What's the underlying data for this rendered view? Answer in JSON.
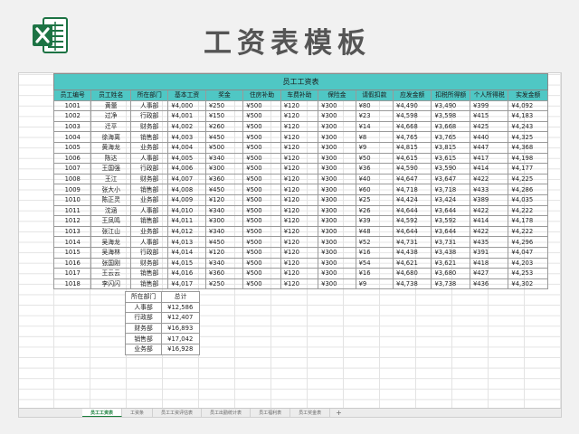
{
  "banner": {
    "title": "工资表模板",
    "logo_icon": "excel-logo-icon",
    "logo_color": "#1d7344"
  },
  "colors": {
    "header_teal": "#4fc7c4",
    "active_tab": "#1a7f3c"
  },
  "sheet": {
    "title": "员工工资表",
    "headers": [
      "员工编号",
      "员工姓名",
      "所在部门",
      "基本工资",
      "奖金",
      "住房补助",
      "车费补助",
      "保险金",
      "请假扣款",
      "应发金额",
      "扣税所得额",
      "个人所得税",
      "实发金额"
    ],
    "rows": [
      [
        "1001",
        "黄蕾",
        "人事部",
        "¥4,000",
        "¥250",
        "¥500",
        "¥120",
        "¥300",
        "¥80",
        "¥4,490",
        "¥3,490",
        "¥399",
        "¥4,092"
      ],
      [
        "1002",
        "过净",
        "行政部",
        "¥4,001",
        "¥150",
        "¥500",
        "¥120",
        "¥300",
        "¥23",
        "¥4,598",
        "¥3,598",
        "¥415",
        "¥4,183"
      ],
      [
        "1003",
        "迁平",
        "财务部",
        "¥4,002",
        "¥260",
        "¥500",
        "¥120",
        "¥300",
        "¥14",
        "¥4,668",
        "¥3,668",
        "¥425",
        "¥4,243"
      ],
      [
        "1004",
        "徐海离",
        "销售部",
        "¥4,003",
        "¥450",
        "¥500",
        "¥120",
        "¥300",
        "¥8",
        "¥4,765",
        "¥3,765",
        "¥440",
        "¥4,325"
      ],
      [
        "1005",
        "黄海龙",
        "业务部",
        "¥4,004",
        "¥500",
        "¥500",
        "¥120",
        "¥300",
        "¥9",
        "¥4,815",
        "¥3,815",
        "¥447",
        "¥4,368"
      ],
      [
        "1006",
        "陈达",
        "人事部",
        "¥4,005",
        "¥340",
        "¥500",
        "¥120",
        "¥300",
        "¥50",
        "¥4,615",
        "¥3,615",
        "¥417",
        "¥4,198"
      ],
      [
        "1007",
        "王国强",
        "行政部",
        "¥4,006",
        "¥300",
        "¥500",
        "¥120",
        "¥300",
        "¥36",
        "¥4,590",
        "¥3,590",
        "¥414",
        "¥4,177"
      ],
      [
        "1008",
        "王江",
        "财务部",
        "¥4,007",
        "¥360",
        "¥500",
        "¥120",
        "¥300",
        "¥40",
        "¥4,647",
        "¥3,647",
        "¥422",
        "¥4,225"
      ],
      [
        "1009",
        "张大小",
        "销售部",
        "¥4,008",
        "¥450",
        "¥500",
        "¥120",
        "¥300",
        "¥60",
        "¥4,718",
        "¥3,718",
        "¥433",
        "¥4,286"
      ],
      [
        "1010",
        "陈正灵",
        "业务部",
        "¥4,009",
        "¥120",
        "¥500",
        "¥120",
        "¥300",
        "¥25",
        "¥4,424",
        "¥3,424",
        "¥389",
        "¥4,035"
      ],
      [
        "1011",
        "沈涵",
        "人事部",
        "¥4,010",
        "¥340",
        "¥500",
        "¥120",
        "¥300",
        "¥26",
        "¥4,644",
        "¥3,644",
        "¥422",
        "¥4,222"
      ],
      [
        "1012",
        "王凤鸣",
        "销售部",
        "¥4,011",
        "¥300",
        "¥500",
        "¥120",
        "¥300",
        "¥39",
        "¥4,592",
        "¥3,592",
        "¥414",
        "¥4,178"
      ],
      [
        "1013",
        "张江山",
        "业务部",
        "¥4,012",
        "¥340",
        "¥500",
        "¥120",
        "¥300",
        "¥48",
        "¥4,644",
        "¥3,644",
        "¥422",
        "¥4,222"
      ],
      [
        "1014",
        "吴海龙",
        "人事部",
        "¥4,013",
        "¥450",
        "¥500",
        "¥120",
        "¥300",
        "¥52",
        "¥4,731",
        "¥3,731",
        "¥435",
        "¥4,296"
      ],
      [
        "1015",
        "吴海林",
        "行政部",
        "¥4,014",
        "¥120",
        "¥500",
        "¥120",
        "¥300",
        "¥16",
        "¥4,438",
        "¥3,438",
        "¥391",
        "¥4,047"
      ],
      [
        "1016",
        "张国刚",
        "财务部",
        "¥4,015",
        "¥340",
        "¥500",
        "¥120",
        "¥300",
        "¥54",
        "¥4,621",
        "¥3,621",
        "¥418",
        "¥4,203"
      ],
      [
        "1017",
        "王云云",
        "销售部",
        "¥4,016",
        "¥360",
        "¥500",
        "¥120",
        "¥300",
        "¥16",
        "¥4,680",
        "¥3,680",
        "¥427",
        "¥4,253"
      ],
      [
        "1018",
        "李闪闪",
        "销售部",
        "¥4,017",
        "¥250",
        "¥500",
        "¥120",
        "¥300",
        "¥9",
        "¥4,738",
        "¥3,738",
        "¥436",
        "¥4,302"
      ]
    ]
  },
  "summary": {
    "headers": [
      "所在部门",
      "总计"
    ],
    "rows": [
      [
        "人事部",
        "¥12,586"
      ],
      [
        "行政部",
        "¥12,407"
      ],
      [
        "财务部",
        "¥16,893"
      ],
      [
        "销售部",
        "¥17,042"
      ],
      [
        "业务部",
        "¥16,928"
      ]
    ]
  },
  "tabs": [
    {
      "label": "员工工资表",
      "active": true
    },
    {
      "label": "工资条",
      "active": false
    },
    {
      "label": "员工工资评估表",
      "active": false
    },
    {
      "label": "员工出勤统计表",
      "active": false
    },
    {
      "label": "员工福利表",
      "active": false
    },
    {
      "label": "员工奖金表",
      "active": false
    }
  ],
  "tab_add_label": "+"
}
